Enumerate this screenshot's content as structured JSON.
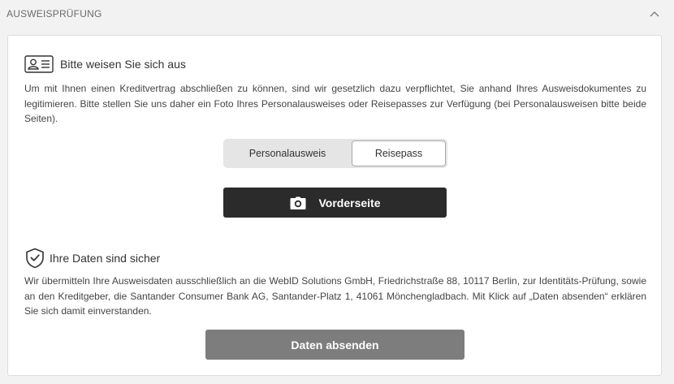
{
  "section": {
    "title": "AUSWEISPRÜFUNG",
    "collapse_icon": "chevron-up-icon"
  },
  "identification": {
    "icon": "id-card-icon",
    "heading": "Bitte weisen Sie sich aus",
    "text": "Um mit Ihnen einen Kreditvertrag abschließen zu können, sind wir gesetzlich dazu verpflichtet, Sie anhand Ihres Ausweisdokumentes zu legitimieren. Bitte stellen Sie uns daher ein Foto Ihres Personalausweises oder Reisepasses zur Verfügung (bei Personalausweisen bitte beide Seiten).",
    "document_options": [
      "Personalausweis",
      "Reisepass"
    ],
    "selected_option": "Reisepass",
    "capture_button": {
      "icon": "camera-icon",
      "label": "Vorderseite"
    }
  },
  "privacy": {
    "icon": "shield-check-icon",
    "heading": "Ihre Daten sind sicher",
    "text": "Wir übermitteln Ihre Ausweisdaten ausschließlich an die WebID Solutions GmbH, Friedrichstraße 88, 10117 Berlin, zur Identitäts-Prüfung, sowie an den Kreditgeber, die Santander Consumer Bank AG, Santander-Platz 1, 41061 Mönchengladbach. Mit Klick auf „Daten absenden“ erklären Sie sich damit einverstanden.",
    "submit_label": "Daten absenden"
  },
  "colors": {
    "page_background": "#f2f2f2",
    "card_background": "#ffffff",
    "primary_button": "#2b2b2b",
    "submit_button": "#7d7d7d",
    "toggle_track": "#e5e5e5"
  }
}
